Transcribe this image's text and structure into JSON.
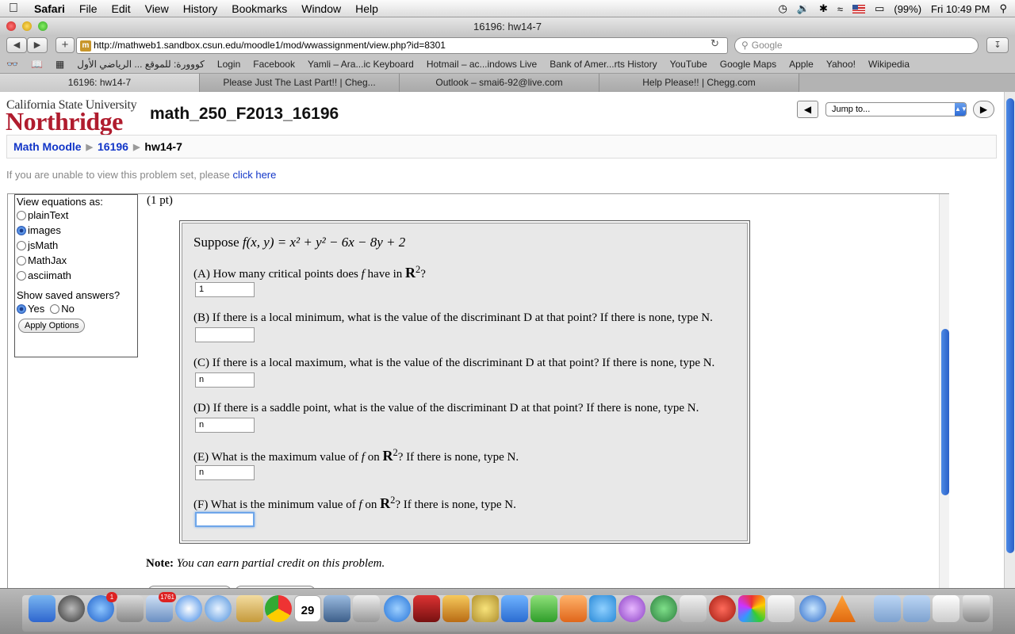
{
  "menubar": {
    "app": "Safari",
    "items": [
      "File",
      "Edit",
      "View",
      "History",
      "Bookmarks",
      "Window",
      "Help"
    ],
    "battery": "(99%)",
    "clock": "Fri 10:49 PM"
  },
  "window": {
    "title": "16196: hw14-7"
  },
  "toolbar": {
    "url": "http://mathweb1.sandbox.csun.edu/moodle1/mod/wwassignment/view.php?id=8301",
    "search_placeholder": "Google"
  },
  "bookmarks": [
    "كووورة: للموقع ... الرياضي الأول",
    "Login",
    "Facebook",
    "Yamli – Ara...ic Keyboard",
    "Hotmail – ac...indows Live",
    "Bank of Amer...rts History",
    "YouTube",
    "Google Maps",
    "Apple",
    "Yahoo!",
    "Wikipedia"
  ],
  "tabs": [
    {
      "label": "16196: hw14-7",
      "active": true
    },
    {
      "label": "Please Just The Last Part!! | Cheg...",
      "active": false
    },
    {
      "label": "Outlook – smai6-92@live.com",
      "active": false
    },
    {
      "label": "Help Please!! | Chegg.com",
      "active": false
    }
  ],
  "page": {
    "logo_top": "California State University",
    "logo_bottom": "Northridge",
    "course_title": "math_250_F2013_16196",
    "jump_label": "Jump to...",
    "breadcrumb": [
      "Math Moodle",
      "16196",
      "hw14-7"
    ],
    "unable_text": "If you are unable to view this problem set, please",
    "unable_link": "click here"
  },
  "options": {
    "view_label": "View equations as:",
    "modes": [
      {
        "label": "plainText",
        "selected": false
      },
      {
        "label": "images",
        "selected": true
      },
      {
        "label": "jsMath",
        "selected": false
      },
      {
        "label": "MathJax",
        "selected": false
      },
      {
        "label": "asciimath",
        "selected": false
      }
    ],
    "saved_label": "Show saved answers?",
    "yes": "Yes",
    "no": "No",
    "apply": "Apply Options"
  },
  "problem": {
    "points": "(1 pt)",
    "statement_prefix": "Suppose",
    "statement_math": "f(x, y) = x² + y² − 6x − 8y + 2",
    "questions": [
      {
        "pre": "(A) How many critical points does",
        "var": "f",
        "mid": "have in",
        "space": "R",
        "exp": "2",
        "post": "?",
        "answer": "1"
      },
      {
        "pre": "(B) If there is a local minimum, what is the value of the discriminant D at that point? If there is none, type N.",
        "answer": ""
      },
      {
        "pre": "(C) If there is a local maximum, what is the value of the discriminant D at that point? If there is none, type N.",
        "answer": "n"
      },
      {
        "pre": "(D) If there is a saddle point, what is the value of the discriminant D at that point? If there is none, type N.",
        "answer": "n"
      },
      {
        "pre": "(E) What is the maximum value of",
        "var": "f",
        "mid": "on",
        "space": "R",
        "exp": "2",
        "post": "? If there is none, type N.",
        "answer": "n"
      },
      {
        "pre": "(F) What is the minimum value of",
        "var": "f",
        "mid": "on",
        "space": "R",
        "exp": "2",
        "post": "? If there is none, type N.",
        "answer": ""
      }
    ],
    "note_label": "Note:",
    "note_text": "You can earn partial credit on this problem."
  },
  "dock": {
    "mail_badge": "1761",
    "appstore_badge": "1",
    "calendar_day": "29"
  }
}
